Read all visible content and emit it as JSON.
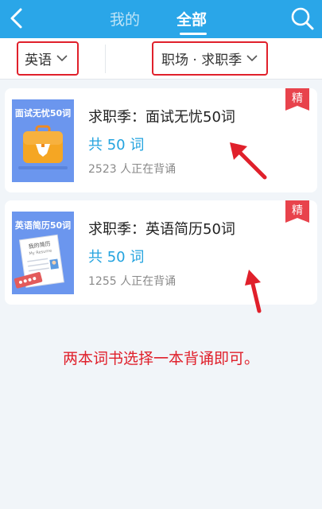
{
  "header": {
    "tabs": [
      {
        "label": "我的",
        "active": false
      },
      {
        "label": "全部",
        "active": true
      }
    ],
    "back_icon": "back-chevron-icon",
    "search_icon": "search-icon"
  },
  "filters": {
    "language": "英语",
    "category": "职场 · 求职季"
  },
  "books": [
    {
      "cover_title": "面试无忧50词",
      "title": "求职季：面试无忧50词",
      "word_count": "共 50 词",
      "learners": "2523 人正在背诵",
      "badge": "精"
    },
    {
      "cover_title": "英语简历50词",
      "cover_sub1": "我的简历",
      "cover_sub2": "My Resume",
      "title": "求职季：英语简历50词",
      "word_count": "共 50 词",
      "learners": "1255 人正在背诵",
      "badge": "精"
    }
  ],
  "annotation_note": "两本词书选择一本背诵即可。",
  "colors": {
    "header": "#2aa6e8",
    "accent_red": "#e0202b",
    "word_count": "#23a3df",
    "cover": "#6b96ee"
  }
}
